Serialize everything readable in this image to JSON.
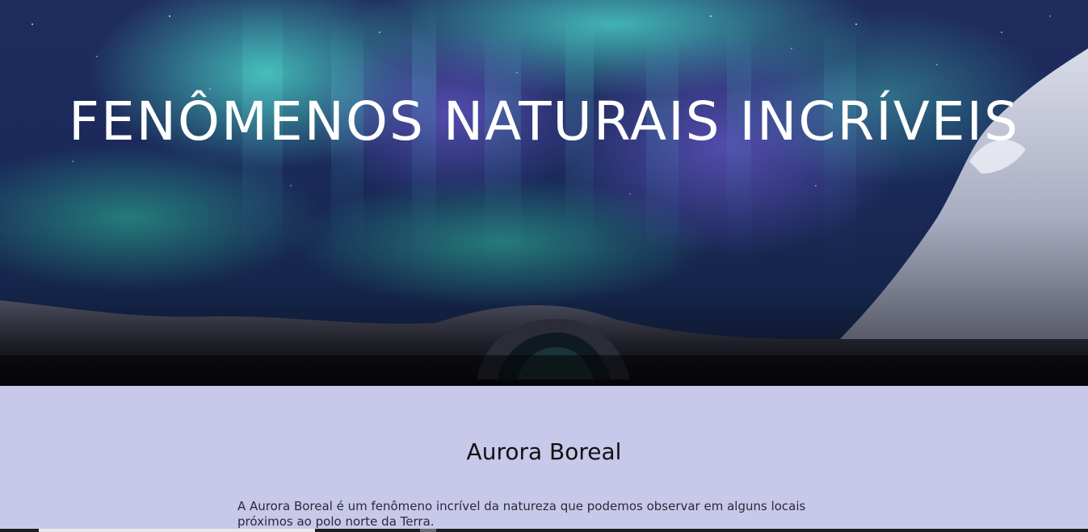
{
  "hero": {
    "title": "FENÔMENOS NATURAIS INCRÍVEIS",
    "image_icon": "aurora-landscape-image"
  },
  "section": {
    "title": "Aurora Boreal",
    "text": "A Aurora Boreal é um fenômeno incrível da natureza que podemos observar em alguns locais próximos ao polo norte da Terra."
  },
  "colors": {
    "content_background": "#c8c8ea",
    "hero_title": "#ffffff",
    "aurora_green": "#3fd6c4",
    "aurora_purple": "#5b4fb8",
    "sky_dark": "#141a3e"
  }
}
